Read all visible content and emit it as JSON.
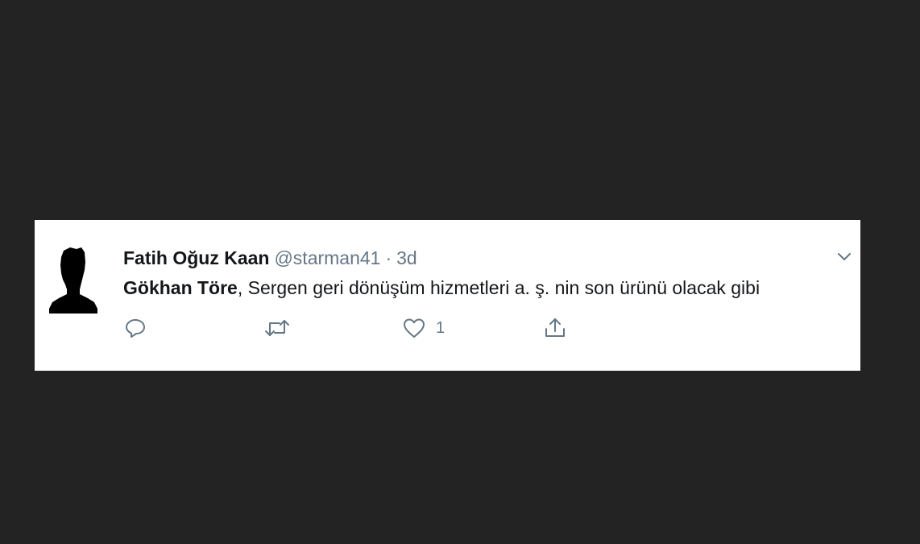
{
  "tweet": {
    "display_name": "Fatih Oğuz Kaan",
    "handle": "@starman41",
    "separator": "·",
    "time": "3d",
    "mention": "Gökhan Töre",
    "text": ", Sergen geri dönüşüm hizmetleri a. ş. nin son ürünü olacak gibi",
    "actions": {
      "reply_icon": "reply-icon",
      "retweet_icon": "retweet-icon",
      "like_icon": "heart-icon",
      "like_count": "1",
      "share_icon": "share-icon"
    },
    "menu_icon": "chevron-down-icon"
  },
  "colors": {
    "background": "#232323",
    "card": "#ffffff",
    "text": "#14171a",
    "secondary": "#657786"
  }
}
